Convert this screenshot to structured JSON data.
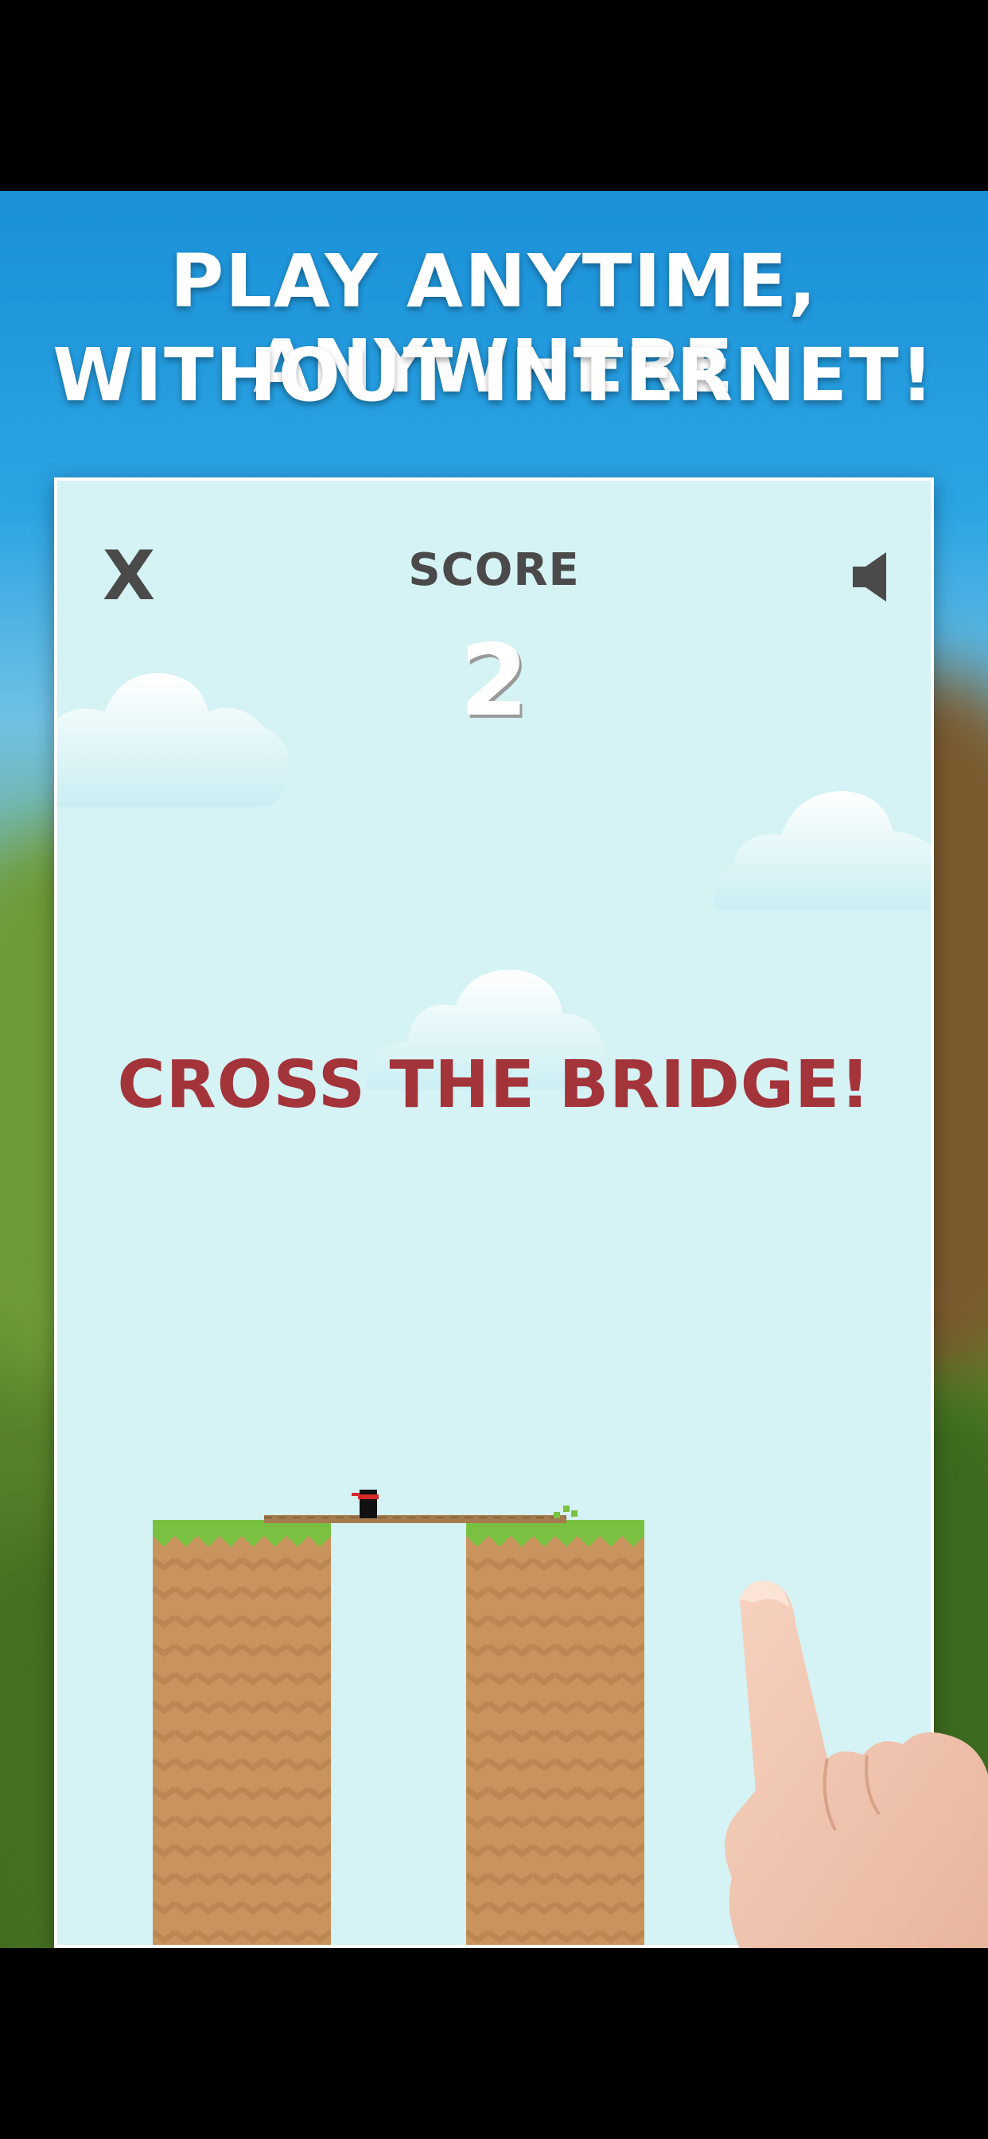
{
  "promo": {
    "headline_line1": "PLAY ANYTIME, ANYWHERE",
    "headline_line2": "WITHOUT INTERNET!"
  },
  "game": {
    "close_label": "X",
    "score_label": "SCORE",
    "score_value": "2",
    "instruction": "CROSS THE BRIDGE!",
    "icons": {
      "close": "close-icon",
      "sound": "speaker-icon",
      "hand": "pointing-hand-icon"
    }
  },
  "colors": {
    "sky_top": "#1b90d8",
    "game_bg": "#d5f2f5",
    "grass": "#7ac142",
    "dirt": "#c9935e",
    "instruction_red": "#a3343a",
    "text_dark": "#4a4a4a"
  }
}
